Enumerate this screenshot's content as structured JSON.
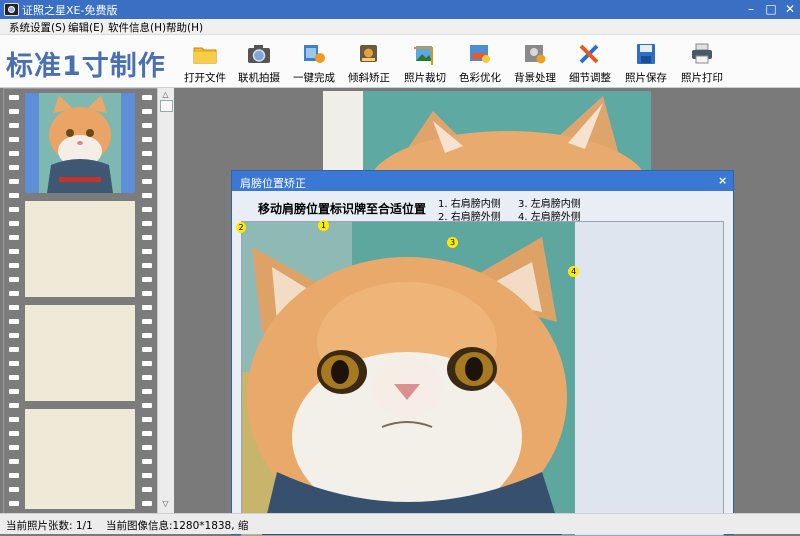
{
  "window": {
    "title": "证照之星XE-免费版"
  },
  "menu": [
    "系统设置(S)",
    "编辑(E)",
    "软件信息(H)",
    "帮助(H)"
  ],
  "brand": "标准1寸制作",
  "toolbar": [
    {
      "label": "打开文件",
      "icon": "folder-icon"
    },
    {
      "label": "联机拍摄",
      "icon": "camera-icon"
    },
    {
      "label": "一键完成",
      "icon": "one-click-icon"
    },
    {
      "label": "倾斜矫正",
      "icon": "tilt-correct-icon"
    },
    {
      "label": "照片裁切",
      "icon": "crop-icon"
    },
    {
      "label": "色彩优化",
      "icon": "color-optimize-icon"
    },
    {
      "label": "背景处理",
      "icon": "background-icon"
    },
    {
      "label": "细节调整",
      "icon": "detail-adjust-icon"
    },
    {
      "label": "照片保存",
      "icon": "save-icon"
    },
    {
      "label": "照片打印",
      "icon": "printer-icon"
    }
  ],
  "status": {
    "count": "当前照片张数: 1/1",
    "info": "当前图像信息:1280*1838, 缩"
  },
  "dialog": {
    "title": "肩膀位置矫正",
    "instruction": "移动肩膀位置标识牌至合适位置",
    "legend": [
      "1. 右肩膀内侧",
      "2. 右肩膀外侧",
      "3. 左肩膀内侧",
      "4. 左肩膀外侧"
    ],
    "markers": [
      "1",
      "2",
      "3",
      "4"
    ]
  },
  "colors": {
    "accent": "#3b78d4",
    "brand": "#4a70b3",
    "marker": "#ffea00"
  }
}
